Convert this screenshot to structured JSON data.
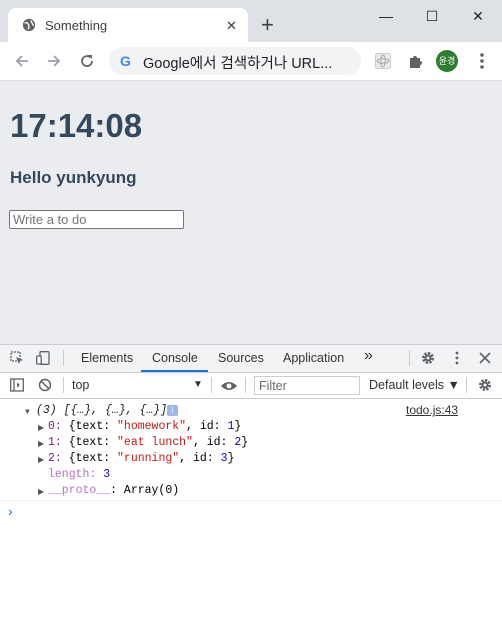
{
  "browser": {
    "tab_title": "Something",
    "tab_close": "✕",
    "new_tab": "+",
    "window_controls": {
      "minimize": "—",
      "maximize": "☐",
      "close": "✕"
    },
    "omnibox_placeholder": "Google에서 검색하거나 URL...",
    "google_logo": "G",
    "profile_initials": "윤경"
  },
  "page": {
    "clock": "17:14:08",
    "greeting": "Hello yunkyung",
    "todo_placeholder": "Write a to do"
  },
  "devtools": {
    "tabs": [
      "Elements",
      "Console",
      "Sources",
      "Application"
    ],
    "active_tab": "Console",
    "more_tabs": "»",
    "context": "top",
    "filter_placeholder": "Filter",
    "levels": "Default levels ▼",
    "accent_color": "#1a73e8"
  },
  "console": {
    "source": "todo.js:43",
    "summary": "(3) [{…}, {…}, {…}]",
    "info_badge": "i",
    "entries": [
      {
        "index": "0:",
        "text": "\"homework\"",
        "id": "1"
      },
      {
        "index": "1:",
        "text": "\"eat lunch\"",
        "id": "2"
      },
      {
        "index": "2:",
        "text": "\"running\"",
        "id": "3"
      }
    ],
    "length_label": "length:",
    "length_value": "3",
    "proto_label": "__proto__",
    "proto_value": ": Array(0)",
    "prompt": "›"
  }
}
